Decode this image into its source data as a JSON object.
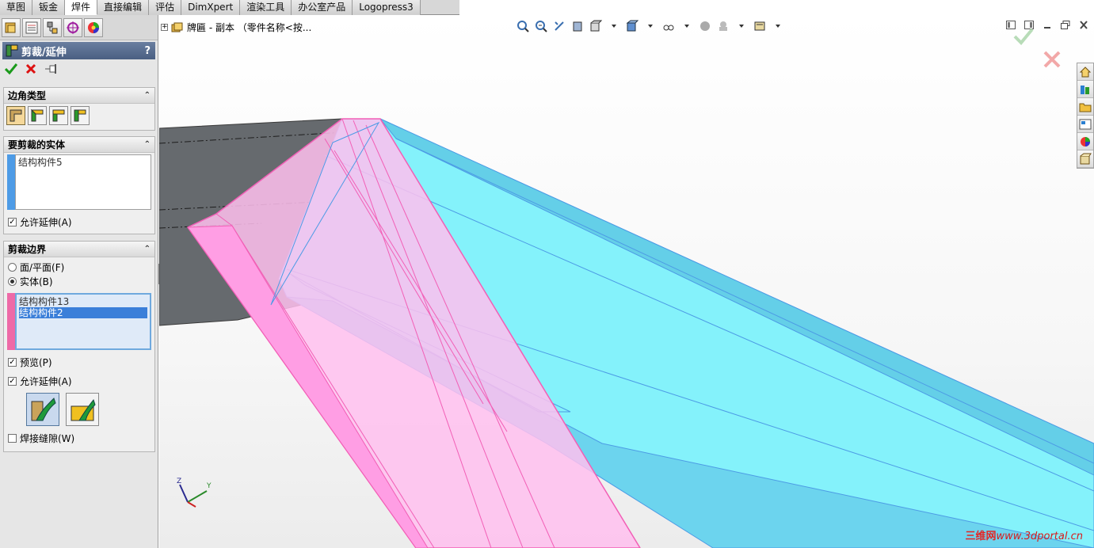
{
  "tabs": [
    "草图",
    "钣金",
    "焊件",
    "直接编辑",
    "评估",
    "DimXpert",
    "渲染工具",
    "办公室产品",
    "Logopress3"
  ],
  "active_tab": "焊件",
  "property_manager": {
    "title": "剪裁/延伸",
    "help": "?",
    "corner_type": {
      "heading": "边角类型"
    },
    "bodies_to_trim": {
      "heading": "要剪裁的实体",
      "items": [
        "结构构件5"
      ],
      "allow_extension": "允许延伸(A)",
      "color": "#4d9be6"
    },
    "trim_boundary": {
      "heading": "剪裁边界",
      "option_face": "面/平面(F)",
      "option_body": "实体(B)",
      "items": [
        "结构构件13",
        "结构构件2"
      ],
      "selected_index": 1,
      "preview": "预览(P)",
      "allow_extension": "允许延伸(A)",
      "weld_gap": "焊接缝隙(W)",
      "color": "#ee6aa7"
    }
  },
  "viewport": {
    "tree_label": "牌匾 - 副本 （零件名称<按...",
    "watermark_cn": "三维网",
    "watermark_url": "www.3dportal.cn"
  },
  "colors": {
    "cyan_body": "#7ff0fa",
    "pink_body": "#ffb4ee",
    "gray_body": "#6b6b6b"
  }
}
